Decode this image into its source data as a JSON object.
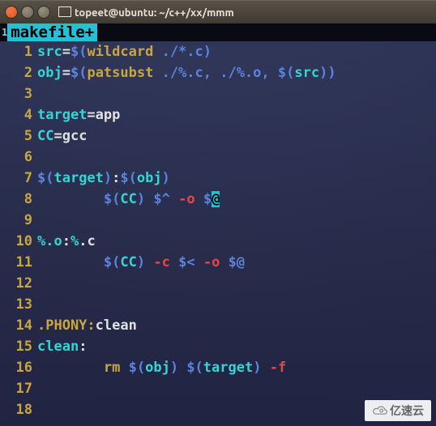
{
  "window": {
    "title": "topeet@ubuntu: ~/c++/xx/mmm"
  },
  "tab": {
    "index": "1",
    "label": "makefile+"
  },
  "gutter": [
    "1",
    "2",
    "3",
    "4",
    "5",
    "6",
    "7",
    "8",
    "9",
    "10",
    "11",
    "12",
    "13",
    "14",
    "15",
    "16",
    "17",
    "18"
  ],
  "code": {
    "l1": {
      "a": "src",
      "b": "=",
      "c": "$(",
      "d": "wildcard",
      "e": " ./*.c",
      "f": ")"
    },
    "l2": {
      "a": "obj",
      "b": "=",
      "c": "$(",
      "d": "patsubst",
      "e": " ./%.c, ./%.o, ",
      "f": "$(",
      "g": "src",
      "h": ")",
      "i": ")"
    },
    "l4": {
      "a": "target",
      "b": "=",
      "c": "app"
    },
    "l5": {
      "a": "CC",
      "b": "=",
      "c": "gcc"
    },
    "l7": {
      "a": "$(",
      "b": "target",
      "c": ")",
      "d": ":",
      "e": "$(",
      "f": "obj",
      "g": ")"
    },
    "l8": {
      "indent": "        ",
      "a": "$(",
      "b": "CC",
      "c": ")",
      "sp1": " ",
      "d": "$^",
      "sp2": " ",
      "e": "-o",
      "sp3": " ",
      "f": "$",
      "g": "@"
    },
    "l10": {
      "a": "%.o",
      "b": ":",
      "c": "%",
      "d": ".c"
    },
    "l11": {
      "indent": "        ",
      "a": "$(",
      "b": "CC",
      "c": ")",
      "sp1": " ",
      "d": "-c",
      "sp2": " ",
      "e": "$<",
      "sp3": " ",
      "f": "-o",
      "sp4": " ",
      "g": "$@"
    },
    "l14": {
      "a": ".PHONY:",
      "b": "clean"
    },
    "l15": {
      "a": "clean",
      "b": ":"
    },
    "l16": {
      "indent": "        ",
      "a": "rm ",
      "b": "$(",
      "c": "obj",
      "d": ")",
      "sp1": " ",
      "e": "$(",
      "f": "target",
      "g": ")",
      "sp2": " ",
      "h": "-f"
    }
  },
  "watermark": {
    "text": "亿速云"
  }
}
